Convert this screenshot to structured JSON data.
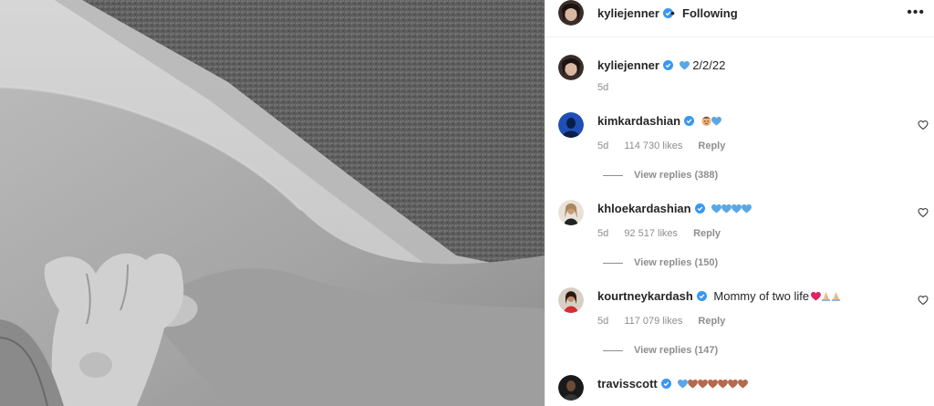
{
  "header": {
    "username": "kyliejenner",
    "separator": "•",
    "follow_status": "Following",
    "more_label": "•••"
  },
  "caption": {
    "username": "kyliejenner",
    "text": "2/2/22",
    "emoji": "blue-heart",
    "time": "5d"
  },
  "comments": [
    {
      "username": "kimkardashian",
      "emojis": [
        "face-emoji",
        "blue-heart"
      ],
      "time": "5d",
      "likes": "114 730 likes",
      "reply_label": "Reply",
      "view_replies": "View replies (388)"
    },
    {
      "username": "khloekardashian",
      "emojis": [
        "blue-heart",
        "blue-heart",
        "blue-heart",
        "blue-heart"
      ],
      "time": "5d",
      "likes": "92 517 likes",
      "reply_label": "Reply",
      "view_replies": "View replies (150)"
    },
    {
      "username": "kourtneykardash",
      "text": "Mommy of two life",
      "emojis": [
        "red-heart",
        "praying-hands",
        "praying-hands"
      ],
      "time": "5d",
      "likes": "117 079 likes",
      "reply_label": "Reply",
      "view_replies": "View replies (147)"
    },
    {
      "username": "travisscott",
      "emojis": [
        "blue-heart",
        "brown-heart",
        "brown-heart",
        "brown-heart",
        "brown-heart",
        "brown-heart",
        "brown-heart"
      ]
    }
  ],
  "colors": {
    "verified": "#3897f0",
    "blue_heart": "#5aa7e6",
    "brown_heart": "#b5694e",
    "red_heart": "#e0245e",
    "meta_gray": "#8e8e8e"
  }
}
